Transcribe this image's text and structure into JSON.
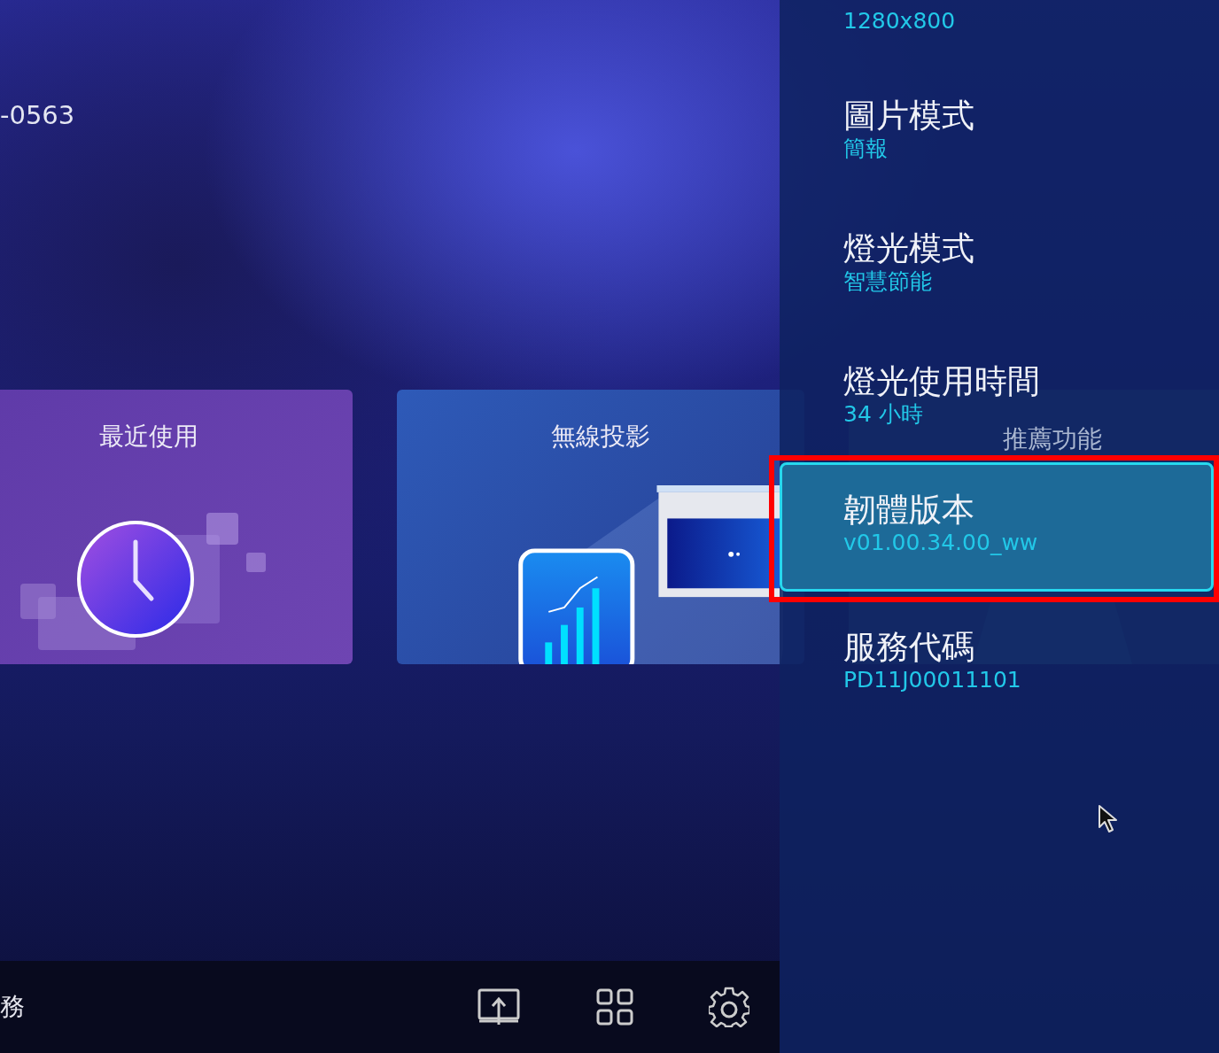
{
  "home": {
    "device_name": "-0563",
    "tiles": [
      {
        "title": "最近使用",
        "kind": "recent"
      },
      {
        "title": "無線投影",
        "kind": "wireless"
      },
      {
        "title": "推薦功能",
        "kind": "recommended"
      }
    ],
    "bottom_bar": {
      "label": "務"
    }
  },
  "info_panel": {
    "items": [
      {
        "value": "1280x800",
        "selected": false,
        "highlighted": false
      },
      {
        "label": "圖片模式",
        "value": "簡報",
        "selected": false,
        "highlighted": false
      },
      {
        "label": "燈光模式",
        "value": "智慧節能",
        "selected": false,
        "highlighted": false
      },
      {
        "label": "燈光使用時間",
        "value": "34 小時",
        "selected": false,
        "highlighted": false
      },
      {
        "label": "韌體版本",
        "value": "v01.00.34.00_ww",
        "selected": true,
        "highlighted": true
      },
      {
        "label": "服務代碼",
        "value": "PD11J00011101",
        "selected": false,
        "highlighted": false
      }
    ]
  }
}
